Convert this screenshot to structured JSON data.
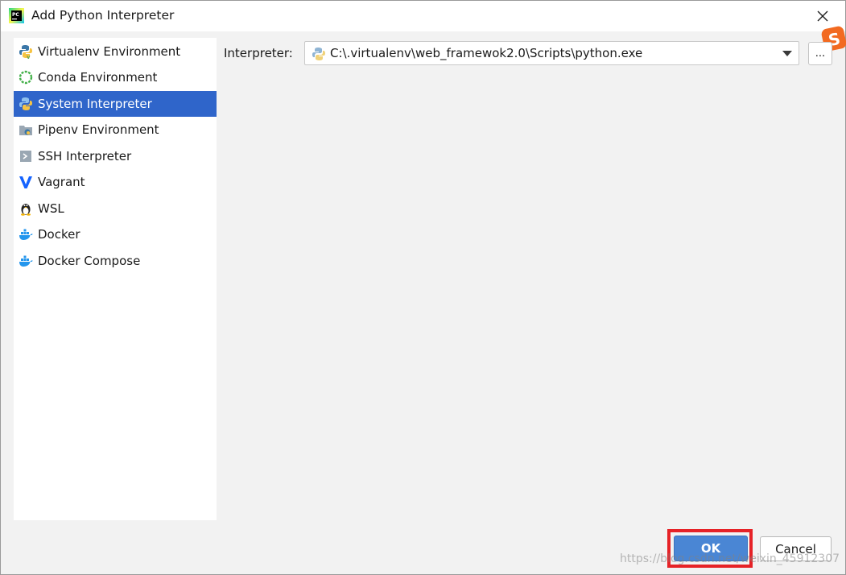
{
  "window": {
    "title": "Add Python Interpreter",
    "app_icon": "pycharm-icon",
    "close_icon": "close-icon"
  },
  "sidebar": {
    "items": [
      {
        "label": "Virtualenv Environment",
        "icon": "virtualenv-icon",
        "selected": false
      },
      {
        "label": "Conda Environment",
        "icon": "conda-icon",
        "selected": false
      },
      {
        "label": "System Interpreter",
        "icon": "python-icon",
        "selected": true
      },
      {
        "label": "Pipenv Environment",
        "icon": "pipenv-icon",
        "selected": false
      },
      {
        "label": "SSH Interpreter",
        "icon": "ssh-icon",
        "selected": false
      },
      {
        "label": "Vagrant",
        "icon": "vagrant-icon",
        "selected": false
      },
      {
        "label": "WSL",
        "icon": "linux-penguin-icon",
        "selected": false
      },
      {
        "label": "Docker",
        "icon": "docker-icon",
        "selected": false
      },
      {
        "label": "Docker Compose",
        "icon": "docker-compose-icon",
        "selected": false
      }
    ]
  },
  "main": {
    "interpreter_label": "Interpreter:",
    "interpreter_value": "C:\\.virtualenv\\web_framewok2.0\\Scripts\\python.exe",
    "browse_label": "..."
  },
  "footer": {
    "ok_label": "OK",
    "cancel_label": "Cancel"
  },
  "watermark": "https://blog.csdn.net/weixin_45912307",
  "colors": {
    "selection": "#2f65ca",
    "ok_button": "#4a86d4",
    "highlight_box": "#e62227"
  }
}
